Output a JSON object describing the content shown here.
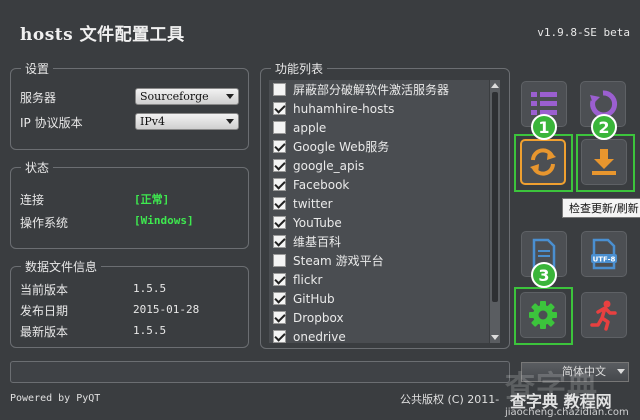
{
  "app": {
    "title": "hosts 文件配置工具",
    "version": "v1.9.8-SE beta"
  },
  "settings": {
    "group_title": "设置",
    "server_label": "服务器",
    "server_value": "Sourceforge",
    "ip_label": "IP 协议版本",
    "ip_value": "IPv4"
  },
  "status": {
    "group_title": "状态",
    "connection_label": "连接",
    "connection_value": "[正常]",
    "os_label": "操作系统",
    "os_value": "[Windows]",
    "status_color": "#3ee94f"
  },
  "data_info": {
    "group_title": "数据文件信息",
    "current_label": "当前版本",
    "current_value": "1.5.5",
    "date_label": "发布日期",
    "date_value": "2015-01-28",
    "latest_label": "最新版本",
    "latest_value": "1.5.5"
  },
  "functions": {
    "group_title": "功能列表",
    "items": [
      {
        "label": "屏蔽部分破解软件激活服务器",
        "checked": false
      },
      {
        "label": "huhamhire-hosts",
        "checked": true
      },
      {
        "label": "apple",
        "checked": false
      },
      {
        "label": "Google Web服务",
        "checked": true
      },
      {
        "label": "google_apis",
        "checked": true
      },
      {
        "label": "Facebook",
        "checked": true
      },
      {
        "label": "twitter",
        "checked": true
      },
      {
        "label": "YouTube",
        "checked": true
      },
      {
        "label": "维基百科",
        "checked": true
      },
      {
        "label": "Steam 游戏平台",
        "checked": false
      },
      {
        "label": "flickr",
        "checked": true
      },
      {
        "label": "GitHub",
        "checked": true
      },
      {
        "label": "Dropbox",
        "checked": true
      },
      {
        "label": "onedrive",
        "checked": true
      }
    ]
  },
  "toolbar": {
    "tooltip": "检查更新/刷新",
    "badges": [
      "1",
      "2",
      "3"
    ],
    "accent": "#3cc43c",
    "buttons": [
      "list-icon",
      "refresh-backup-icon",
      "check-update-icon",
      "download-icon",
      "ansi-file-icon",
      "utf8-file-icon",
      "settings-gear-icon",
      "exit-runner-icon"
    ],
    "utf8_label": "UTF-8"
  },
  "footer": {
    "language": "简体中文",
    "powered_by": "Powered by PyQT",
    "copyright": "公共版权 (C) 2011-"
  },
  "watermark": {
    "big": "查字典",
    "site": "查字典 教程网",
    "url": "jiaocheng.chazidian.com"
  }
}
